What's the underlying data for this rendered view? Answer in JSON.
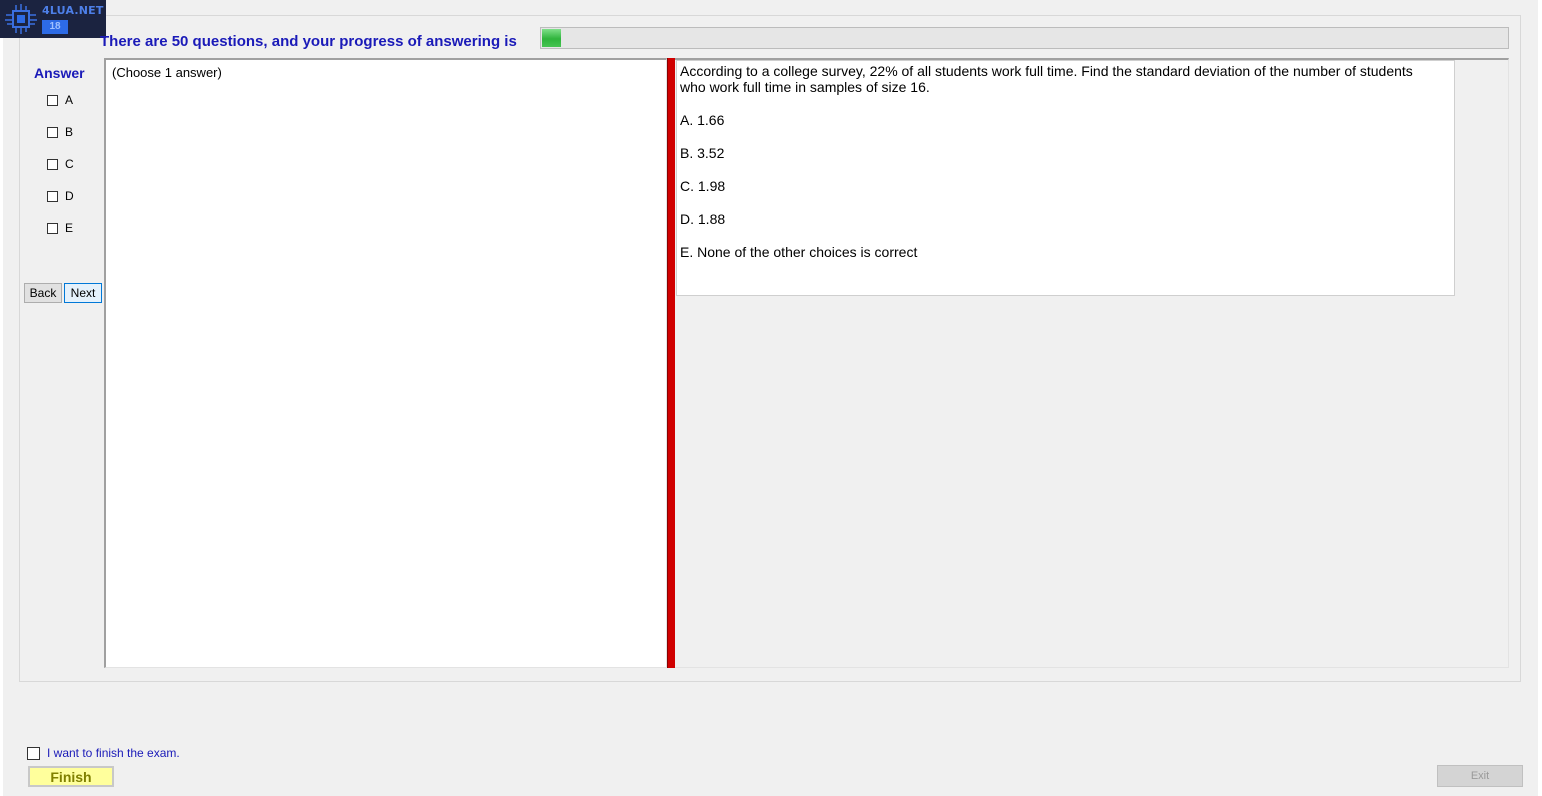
{
  "logo": {
    "brand": "4LUA.NET",
    "badge": "18"
  },
  "progress": {
    "label": "There are 50 questions, and your progress of answering is",
    "fraction": 0.02,
    "fill_color": "#2fb43c"
  },
  "answer_panel": {
    "title": "Answer",
    "options": [
      "A",
      "B",
      "C",
      "D",
      "E"
    ],
    "back_label": "Back",
    "next_label": "Next"
  },
  "left_panel": {
    "hint": "(Choose 1 answer)"
  },
  "question": {
    "text": "According to a college survey, 22% of all students work full time. Find the standard deviation of the number of students who work full time in samples of size 16.",
    "choices": [
      "A.  1.66",
      "B.  3.52",
      "C.  1.98",
      "D.  1.88",
      "E.  None of the other choices is correct"
    ]
  },
  "footer": {
    "finish_check_label": "I want to finish the exam.",
    "finish_label": "Finish",
    "exit_label": "Exit"
  },
  "colors": {
    "accent_text": "#1a1ab8",
    "splitter": "#d00000",
    "finish_bg": "#ffff9c"
  }
}
